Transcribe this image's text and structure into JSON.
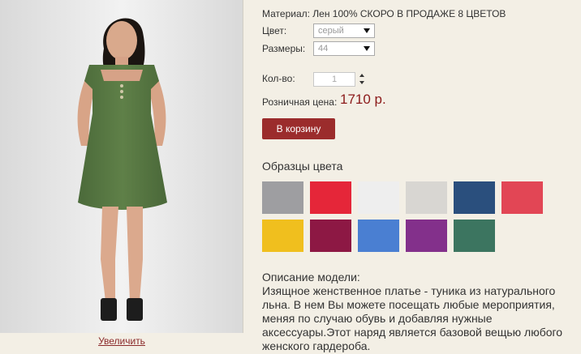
{
  "product": {
    "material_line": "Материал: Лен 100% СКОРО В ПРОДАЖЕ 8 ЦВЕТОВ",
    "color_label": "Цвет:",
    "color_value": "серый",
    "size_label": "Размеры:",
    "size_value": "44",
    "qty_label": "Кол-во:",
    "qty_value": "1",
    "price_label": "Розничная цена:",
    "price_value": "1710 р.",
    "cart_button": "В корзину",
    "zoom_link": "Увеличить"
  },
  "swatches": {
    "title": "Образцы цвета",
    "colors": [
      "#9e9ea1",
      "#e52639",
      "#eeeeee",
      "#d8d6d2",
      "#2a4f7d",
      "#e24655",
      "#f0bf1e",
      "#8d1844",
      "#4a7fd2",
      "#83308b",
      "#3c7560"
    ]
  },
  "description": {
    "title": "Описание модели:",
    "text": "Изящное женственное платье - туника из натурального льна. В нем Вы можете посещать любые мероприятия, меняя по случаю обувь и добавляя нужные аксессуары.Этот наряд является базовой вещью любого женского гардероба."
  }
}
